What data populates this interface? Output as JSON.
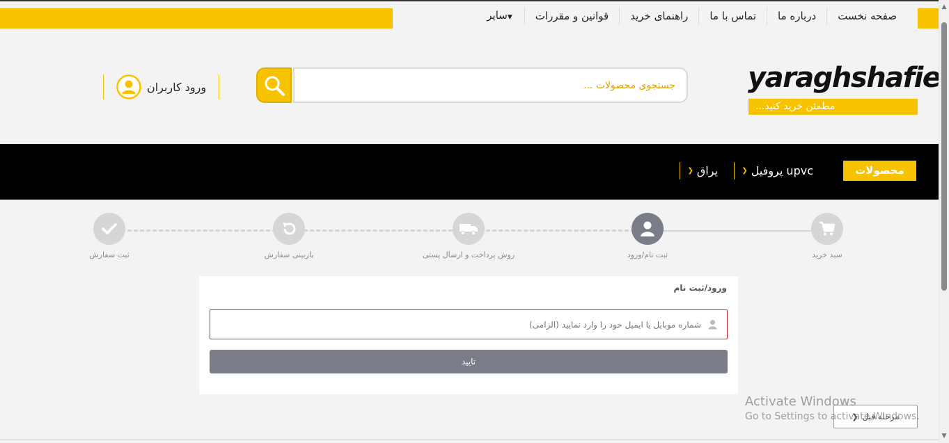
{
  "top_nav": {
    "items": [
      "صفحه نخست",
      "درباره ما",
      "تماس با ما",
      "راهنمای خرید",
      "قوانین و مقررات",
      "سایر"
    ]
  },
  "logo": {
    "text": "yaraghshafie",
    "tagline": "مطمئن خرید کنید..."
  },
  "search": {
    "placeholder": "جستجوی محصولات ..."
  },
  "login": {
    "label": "ورود کاربران"
  },
  "category_bar": {
    "products_label": "محصولات",
    "items": [
      {
        "label": "پروفیل upvc"
      },
      {
        "label": "یراق"
      }
    ]
  },
  "steps": [
    {
      "label": "سبد خرید",
      "icon": "cart-icon",
      "state": "done"
    },
    {
      "label": "ثبت نام/ورود",
      "icon": "user-icon",
      "state": "active"
    },
    {
      "label": "روش پرداخت و ارسال پستی",
      "icon": "truck-icon",
      "state": "pending"
    },
    {
      "label": "بازبینی سفارش",
      "icon": "refresh-icon",
      "state": "pending"
    },
    {
      "label": "ثبت سفارش",
      "icon": "check-icon",
      "state": "pending"
    }
  ],
  "form": {
    "title": "ورود/ثبت نام",
    "phone_placeholder": "شماره موبایل یا ایمیل خود را وارد نمایید (الزامی)",
    "submit_label": "تایید"
  },
  "back_button": {
    "label": "مرحله قبل"
  },
  "watermark": {
    "title": "Activate Windows",
    "subtitle": "Go to Settings to activate Windows."
  },
  "colors": {
    "brand_yellow": "#f7c200",
    "nav_black": "#000000",
    "step_active": "#7a7c87",
    "step_inactive": "#d6d6d6",
    "error_border": "#c42b2b"
  }
}
